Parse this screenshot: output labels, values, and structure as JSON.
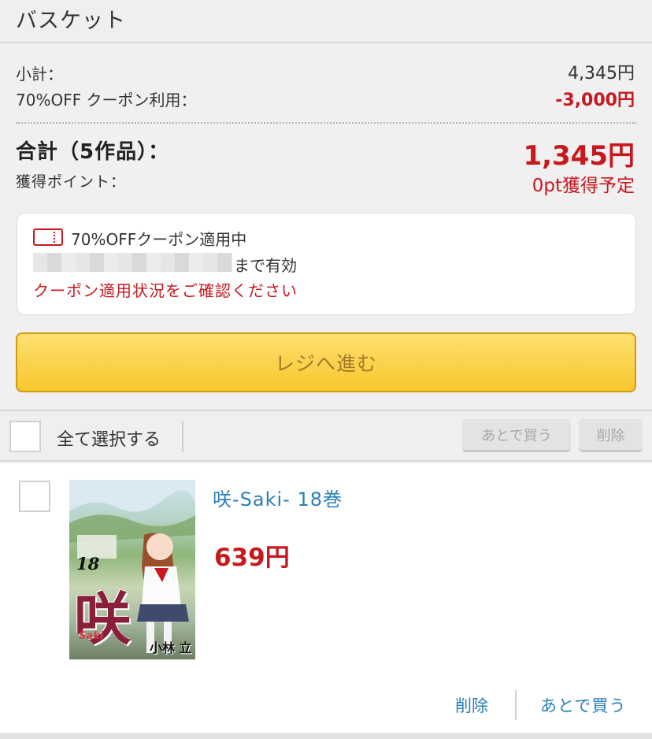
{
  "header": {
    "title": "バスケット"
  },
  "summary": {
    "subtotal_label": "小計：",
    "subtotal_value": "4,345円",
    "coupon_label": "70%OFF クーポン利用：",
    "coupon_value": "-3,000円",
    "total_label": "合計（5作品）：",
    "total_value": "1,345円",
    "points_label": "獲得ポイント：",
    "points_value": "0pt獲得予定"
  },
  "coupon": {
    "icon": "ticket-icon",
    "title": "70%OFFクーポン適用中",
    "until": "まで有効",
    "link": "クーポン適用状況をご確認ください"
  },
  "checkout": {
    "label": "レジへ進む"
  },
  "toolbar": {
    "select_all": "全て選択する",
    "later": "あとで買う",
    "delete": "削除"
  },
  "item": {
    "title": "咲-Saki- 18巻",
    "price": "639円",
    "delete": "削除",
    "later": "あとで買う",
    "cover": {
      "volume": "18",
      "logo": "咲",
      "sub": "Saki",
      "author": "小林 立"
    }
  },
  "colors": {
    "price_red": "#c8181e",
    "link_blue": "#2a7fb8",
    "checkout_yellow": "#f8c72c"
  }
}
